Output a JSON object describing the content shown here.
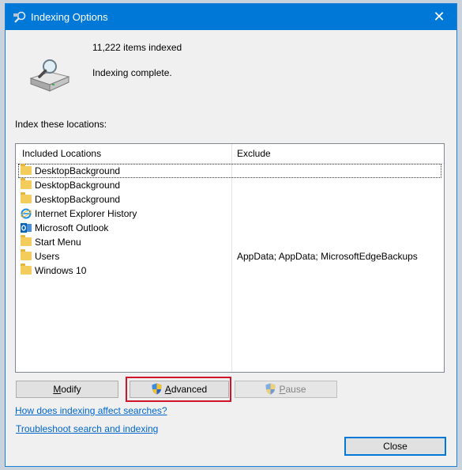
{
  "window": {
    "title": "Indexing Options",
    "close_glyph": "✕",
    "accent_color": "#0078d7"
  },
  "summary": {
    "items_indexed": "11,222 items indexed",
    "status": "Indexing complete."
  },
  "locations": {
    "label": "Index these locations:",
    "columns": {
      "included": "Included Locations",
      "exclude": "Exclude"
    },
    "rows": [
      {
        "name": "DesktopBackground",
        "icon": "folder-icon",
        "exclude": ""
      },
      {
        "name": "DesktopBackground",
        "icon": "folder-icon",
        "exclude": ""
      },
      {
        "name": "DesktopBackground",
        "icon": "folder-icon",
        "exclude": ""
      },
      {
        "name": "Internet Explorer History",
        "icon": "internet-explorer-icon",
        "exclude": ""
      },
      {
        "name": "Microsoft Outlook",
        "icon": "outlook-icon",
        "exclude": ""
      },
      {
        "name": "Start Menu",
        "icon": "folder-icon",
        "exclude": ""
      },
      {
        "name": "Users",
        "icon": "folder-icon",
        "exclude": "AppData; AppData; MicrosoftEdgeBackups"
      },
      {
        "name": "Windows 10",
        "icon": "folder-icon",
        "exclude": ""
      }
    ]
  },
  "buttons": {
    "modify": {
      "first": "M",
      "rest": "odify"
    },
    "advanced": {
      "first": "A",
      "rest": "dvanced"
    },
    "pause": {
      "first": "P",
      "rest": "ause"
    },
    "close": "Close"
  },
  "links": {
    "how_indexing": "How does indexing affect searches?",
    "troubleshoot": "Troubleshoot search and indexing"
  }
}
